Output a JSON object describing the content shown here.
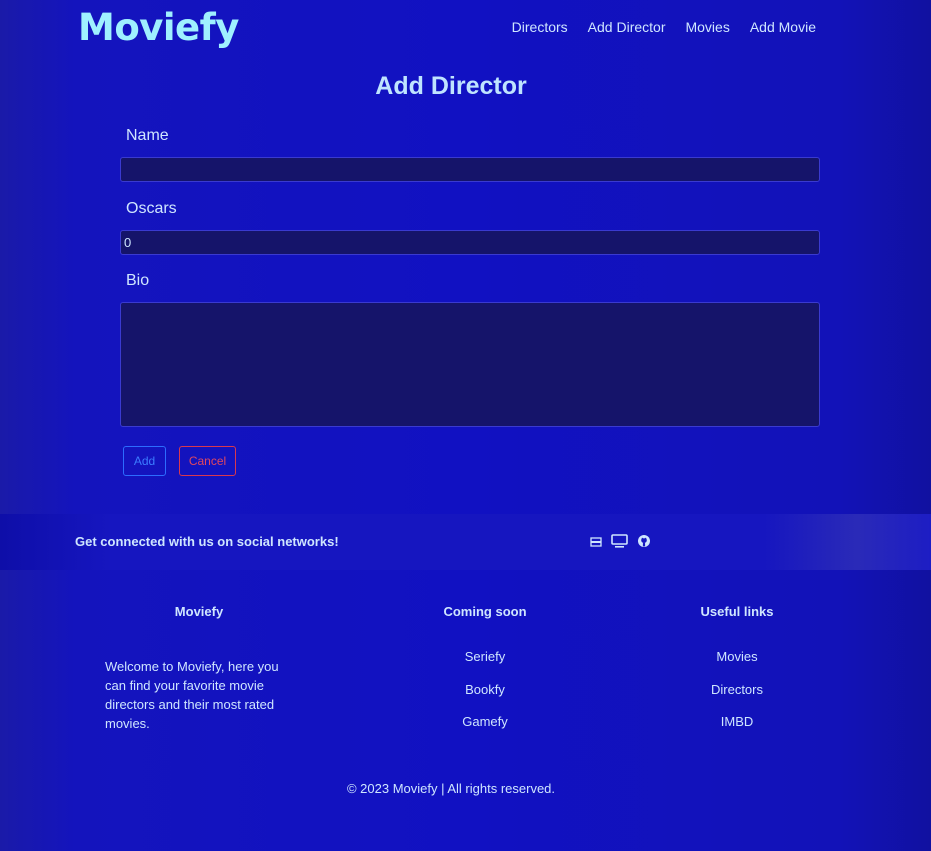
{
  "header": {
    "logo": "Moviefy",
    "nav": [
      "Directors",
      "Add Director",
      "Movies",
      "Add Movie"
    ]
  },
  "form": {
    "title": "Add Director",
    "name_label": "Name",
    "name_value": "",
    "oscars_label": "Oscars",
    "oscars_value": "0",
    "bio_label": "Bio",
    "bio_value": "",
    "add_label": "Add",
    "cancel_label": "Cancel"
  },
  "social": {
    "text": "Get connected with us on social networks!",
    "icons": [
      "card-icon",
      "monitor-icon",
      "github-icon"
    ]
  },
  "footer": {
    "about": {
      "title": "Moviefy",
      "text": "Welcome to Moviefy, here you can find your favorite movie directors and their most rated movies."
    },
    "coming_soon": {
      "title": "Coming soon",
      "items": [
        "Seriefy",
        "Bookfy",
        "Gamefy"
      ]
    },
    "useful_links": {
      "title": "Useful links",
      "items": [
        "Movies",
        "Directors",
        "IMBD"
      ]
    },
    "copyright": "© 2023 Moviefy | All rights reserved."
  },
  "colors": {
    "background": "#1111c2",
    "logo": "#9ff0ff",
    "field": "#15146a",
    "add_button": "#2c6cff",
    "cancel_button": "#d8384f"
  }
}
